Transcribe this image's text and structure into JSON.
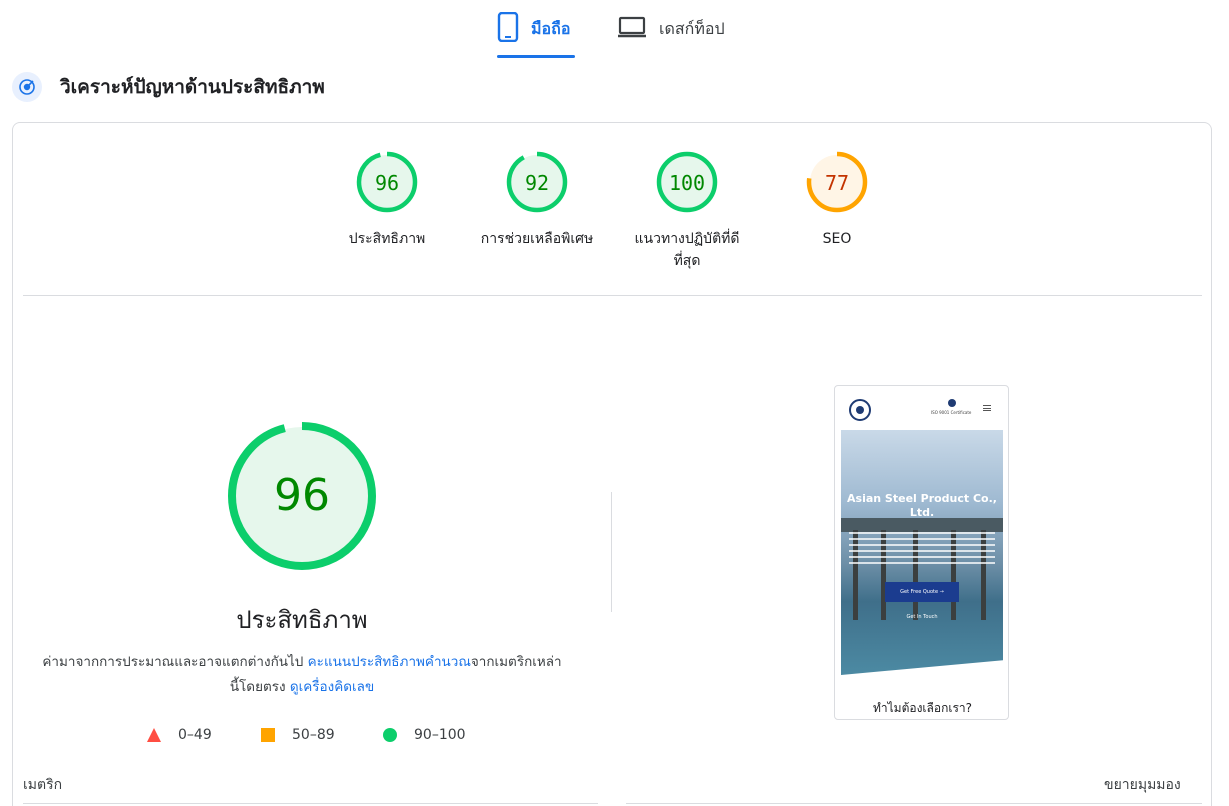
{
  "tabs": {
    "mobile": "มือถือ",
    "desktop": "เดสก์ท็อป",
    "active": "mobile",
    "accent_color": "#1a73e8"
  },
  "header": {
    "title": "วิเคราะห์ปัญหาด้านประสิทธิภาพ"
  },
  "scores": [
    {
      "value": "96",
      "score": 96,
      "label": "ประสิทธิภาพ",
      "status": "pass",
      "color": "#0cce6b"
    },
    {
      "value": "92",
      "score": 92,
      "label": "การช่วยเหลือพิเศษ",
      "status": "pass",
      "color": "#0cce6b"
    },
    {
      "value": "100",
      "score": 100,
      "label": "แนวทางปฏิบัติที่ดีที่สุด",
      "status": "pass",
      "color": "#0cce6b"
    },
    {
      "value": "77",
      "score": 77,
      "label": "SEO",
      "status": "average",
      "color": "#ffa400"
    }
  ],
  "performance": {
    "score": "96",
    "score_value": 96,
    "title": "ประสิทธิภาพ",
    "desc_prefix": "ค่ามาจากการประมาณและอาจแตกต่างกันไป ",
    "desc_link1": "คะแนนประสิทธิภาพคำนวณ",
    "desc_middle": "จากเมตริกเหล่านี้โดยตรง ",
    "desc_link2": "ดูเครื่องคิดเลข"
  },
  "legend": [
    {
      "range": "0–49",
      "shape": "triangle",
      "color": "#ff4e42"
    },
    {
      "range": "50–89",
      "shape": "square",
      "color": "#ffa400"
    },
    {
      "range": "90–100",
      "shape": "circle",
      "color": "#0cce6b"
    }
  ],
  "screenshot": {
    "iso_text": "ISO 9001 Certificate",
    "hero_title": "Asian Steel Product Co., Ltd.",
    "button": "Get Free Quote →",
    "link": "Get In Touch",
    "caption": "ทำไมต้องเลือกเรา?"
  },
  "footer": {
    "metrics_label": "เมตริก",
    "expand_label": "ขยายมุมมอง"
  }
}
